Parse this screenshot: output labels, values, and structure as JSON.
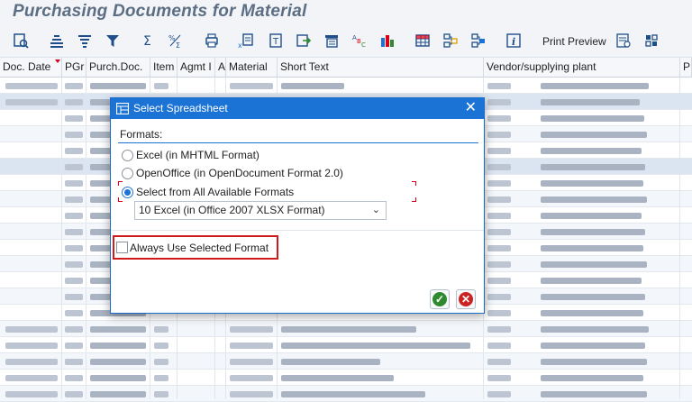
{
  "page": {
    "title": "Purchasing Documents for Material"
  },
  "toolbar": {
    "print_preview_label": "Print Preview",
    "icons": [
      "details-icon",
      "sort-ascending-icon",
      "sort-descending-icon",
      "filter-icon",
      "sum-icon",
      "subtotal-icon",
      "print-icon",
      "export-icon",
      "word-processing-icon",
      "local-file-icon",
      "send-icon",
      "abc-analysis-icon",
      "graphic-icon",
      "layout-icon",
      "select-layout-icon",
      "save-layout-icon",
      "information-icon",
      "column-settings-icon",
      "more-icon"
    ]
  },
  "grid": {
    "columns": [
      "Doc. Date",
      "PGr",
      "Purch.Doc.",
      "Item",
      "Agmt I",
      "A",
      "Material",
      "Short Text",
      "Vendor/supplying plant",
      "P"
    ]
  },
  "dialog": {
    "title": "Select Spreadsheet",
    "formats_label": "Formats:",
    "options": [
      {
        "label": "Excel (in MHTML Format)",
        "checked": false
      },
      {
        "label": "OpenOffice (in OpenDocument Format 2.0)",
        "checked": false
      },
      {
        "label": "Select from All Available Formats",
        "checked": true
      }
    ],
    "selected_format": "10 Excel (in Office 2007 XLSX Format)",
    "always_use_label": "Always Use Selected Format",
    "always_use_checked": false,
    "ok_symbol": "✓",
    "cancel_symbol": "✕",
    "close_symbol": "✕",
    "caret_symbol": "⌄"
  },
  "colors": {
    "accent": "#1c73d6",
    "highlight": "#d11a1a",
    "title": "#5c6e84"
  }
}
